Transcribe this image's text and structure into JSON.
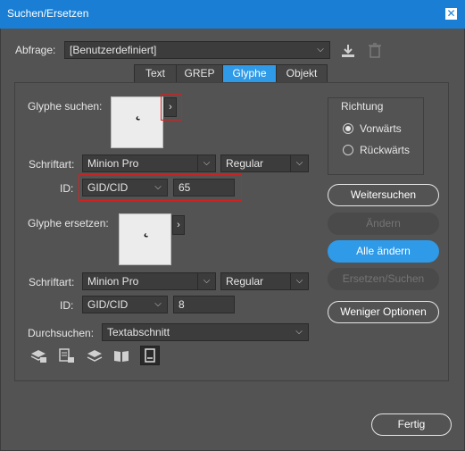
{
  "window": {
    "title": "Suchen/Ersetzen",
    "close_glyph": "✕"
  },
  "query": {
    "label": "Abfrage:",
    "value": "[Benutzerdefiniert]"
  },
  "tabs": [
    {
      "label": "Text",
      "active": false
    },
    {
      "label": "GREP",
      "active": false
    },
    {
      "label": "Glyphe",
      "active": true
    },
    {
      "label": "Objekt",
      "active": false
    }
  ],
  "find": {
    "label": "Glyphe suchen:",
    "glyph": "˛",
    "picker_glyph": "›",
    "font_label": "Schriftart:",
    "font": "Minion Pro",
    "style": "Regular",
    "id_label": "ID:",
    "id_type": "GID/CID",
    "id_value": "65"
  },
  "replace": {
    "label": "Glyphe ersetzen:",
    "glyph": "˛",
    "picker_glyph": "›",
    "font_label": "Schriftart:",
    "font": "Minion Pro",
    "style": "Regular",
    "id_label": "ID:",
    "id_type": "GID/CID",
    "id_value": "8"
  },
  "search_in": {
    "label": "Durchsuchen:",
    "value": "Textabschnitt"
  },
  "direction": {
    "title": "Richtung",
    "options": [
      {
        "label": "Vorwärts",
        "selected": true
      },
      {
        "label": "Rückwärts",
        "selected": false
      }
    ]
  },
  "buttons": {
    "find_next": "Weitersuchen",
    "change": "Ändern",
    "change_all": "Alle ändern",
    "change_find": "Ersetzen/Suchen",
    "fewer_options": "Weniger Optionen",
    "done": "Fertig"
  },
  "option_icons": [
    "include-locked-layers-icon",
    "include-locked-stories-icon",
    "include-hidden-layers-icon",
    "include-master-pages-icon",
    "include-footnotes-icon"
  ],
  "colors": {
    "accent": "#2e9ae8",
    "titlebar": "#1a7fd4",
    "highlight": "#d42020",
    "background": "#535353"
  }
}
